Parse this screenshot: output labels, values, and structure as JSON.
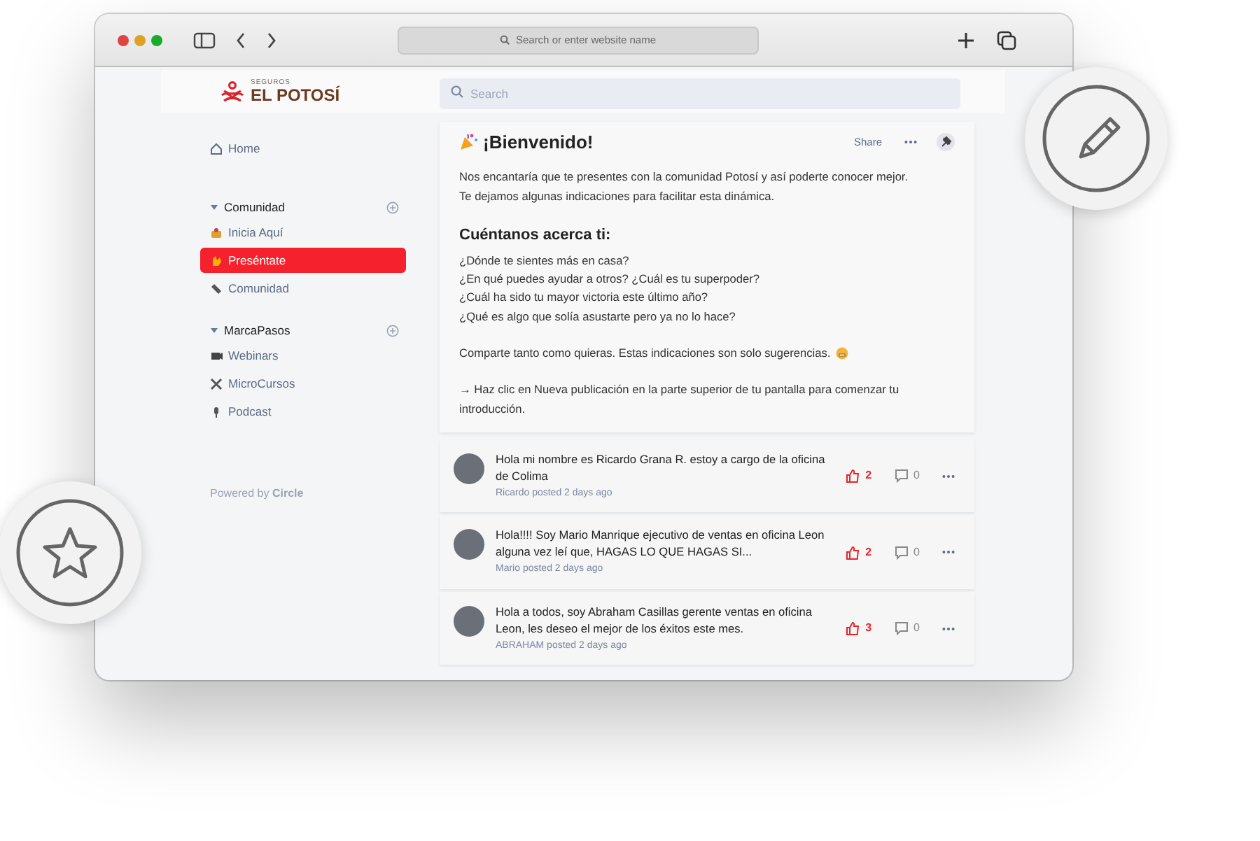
{
  "browser": {
    "address_placeholder": "Search or enter website name"
  },
  "header": {
    "logo_small": "SEGUROS",
    "logo_name": "EL POTOSÍ",
    "search_placeholder": "Search"
  },
  "sidebar": {
    "home": "Home",
    "groups": [
      {
        "label": "Comunidad",
        "expanded": true,
        "items": [
          {
            "label": "Inicia Aquí",
            "selected": false
          },
          {
            "label": "Preséntate",
            "selected": true
          },
          {
            "label": "Comunidad",
            "selected": false
          }
        ]
      },
      {
        "label": "MarcaPasos",
        "expanded": true,
        "items": [
          {
            "label": "Webinars",
            "selected": false
          },
          {
            "label": "MicroCursos",
            "selected": false
          },
          {
            "label": "Podcast",
            "selected": false
          }
        ]
      }
    ],
    "footer": "Powered by **Circle**"
  },
  "post": {
    "title": "¡Bienvenido!",
    "share": "Share",
    "blocks": [
      {
        "kind": "paragraph",
        "lines": [
          "Nos encantaría que te presentes con la comunidad Potosí y así poderte conocer mejor.",
          "Te dejamos algunas indicaciones para facilitar esta dinámica."
        ]
      },
      {
        "kind": "heading",
        "lines": [
          "Cuéntanos acerca ti:"
        ]
      },
      {
        "kind": "paragraph",
        "lines": [
          "¿Dónde te sientes más en casa?",
          "¿En qué puedes ayudar a otros? ¿Cuál es tu superpoder?",
          "¿Cuál ha sido tu mayor victoria este último año?",
          "¿Qué es algo que solía asustarte pero ya no lo hace?"
        ]
      },
      {
        "kind": "emoji_paragraph",
        "lines": [
          "Comparte tanto como quieras. Estas indicaciones son solo sugerencias."
        ]
      },
      {
        "kind": "paragraph",
        "lines": [
          "→ Haz clic en Nueva publicación en la parte superior de tu pantalla para comenzar tu introducción."
        ]
      }
    ]
  },
  "feed": [
    {
      "text": "Hola mi nombre es Ricardo Grana R. estoy a cargo de la oficina de Colima",
      "meta": "Ricardo posted 2 days ago",
      "likes": "2",
      "liked": true,
      "comments": "0"
    },
    {
      "text": "Hola!!!!  Soy Mario Manrique ejecutivo de ventas en oficina Leon alguna vez leí que, HAGAS LO QUE HAGAS SI...",
      "meta": "Mario posted 2 days ago",
      "likes": "2",
      "liked": true,
      "comments": "0"
    },
    {
      "text": "Hola a todos, soy Abraham Casillas gerente ventas en oficina Leon, les deseo el mejor de los éxitos este mes.",
      "meta": "ABRAHAM posted 2 days ago",
      "likes": "3",
      "liked": true,
      "comments": "0"
    }
  ]
}
